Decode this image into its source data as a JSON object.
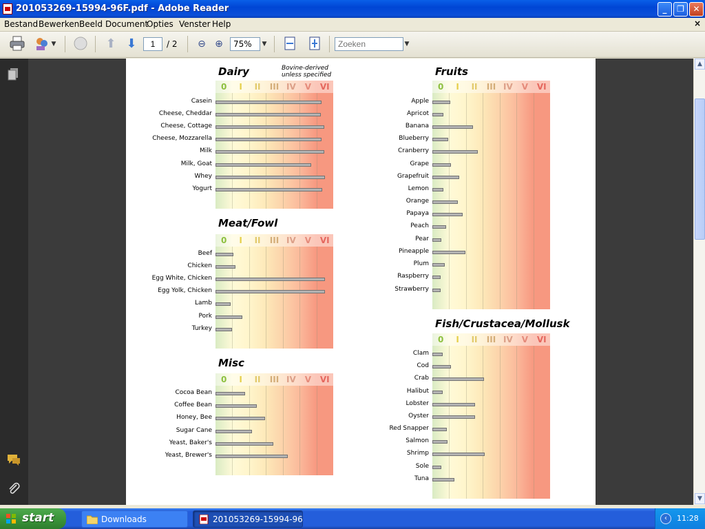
{
  "window": {
    "title": "201053269-15994-96F.pdf - Adobe Reader",
    "controls": [
      "minimize",
      "maximize",
      "close"
    ]
  },
  "menu": {
    "items": [
      "Bestand",
      "Bewerken",
      "Beeld",
      "Document",
      "Opties",
      "Venster",
      "Help"
    ],
    "close_label": "×"
  },
  "toolbar": {
    "page_current": "1",
    "page_total": "/ 2",
    "zoom": "75%",
    "search_placeholder": "Zoeken"
  },
  "document": {
    "zone_labels": [
      "0",
      "I",
      "II",
      "III",
      "IV",
      "V",
      "VI"
    ],
    "zone_colors": [
      "#e6f1cf",
      "#fffbdc",
      "#fff6cc",
      "#fde3b0",
      "#fcc9a6",
      "#fbb39a",
      "#f8a08c"
    ],
    "zone_label_colors": [
      "#8dc03f",
      "#e6cf4a",
      "#e2c96a",
      "#d4ad78",
      "#dc9f88",
      "#e58a7a",
      "#e5675e"
    ],
    "panels": [
      {
        "id": "dairy",
        "title": "Dairy",
        "subtitle_lines": [
          "Bovine-derived",
          "unless specified"
        ],
        "chart_data": {
          "type": "bar",
          "categories": [
            "Casein",
            "Cheese, Cheddar",
            "Cheese, Cottage",
            "Cheese, Mozzarella",
            "Milk",
            "Milk, Goat",
            "Whey",
            "Yogurt"
          ],
          "values": [
            6.3,
            6.25,
            6.45,
            6.3,
            6.45,
            5.7,
            6.5,
            6.35
          ],
          "xlim": [
            0,
            7
          ]
        }
      },
      {
        "id": "meat",
        "title": "Meat/Fowl",
        "subtitle_lines": [],
        "chart_data": {
          "type": "bar",
          "categories": [
            "Beef",
            "Chicken",
            "Egg White, Chicken",
            "Egg Yolk, Chicken",
            "Lamb",
            "Pork",
            "Turkey"
          ],
          "values": [
            1.05,
            1.2,
            6.5,
            6.5,
            0.9,
            1.6,
            1.0
          ],
          "xlim": [
            0,
            7
          ]
        }
      },
      {
        "id": "misc",
        "title": "Misc",
        "subtitle_lines": [],
        "chart_data": {
          "type": "bar",
          "categories": [
            "Cocoa Bean",
            "Coffee Bean",
            "Honey, Bee",
            "Sugar Cane",
            "Yeast, Baker's",
            "Yeast, Brewer's"
          ],
          "values": [
            1.75,
            2.45,
            2.95,
            2.15,
            3.45,
            4.3
          ],
          "xlim": [
            0,
            7
          ]
        }
      },
      {
        "id": "fruits",
        "title": "Fruits",
        "subtitle_lines": [],
        "chart_data": {
          "type": "bar",
          "categories": [
            "Apple",
            "Apricot",
            "Banana",
            "Blueberry",
            "Cranberry",
            "Grape",
            "Grapefruit",
            "Lemon",
            "Orange",
            "Papaya",
            "Peach",
            "Pear",
            "Pineapple",
            "Plum",
            "Raspberry",
            "Strawberry"
          ],
          "values": [
            1.05,
            0.65,
            2.4,
            0.95,
            2.7,
            1.1,
            1.6,
            0.65,
            1.5,
            1.8,
            0.8,
            0.55,
            1.95,
            0.75,
            0.5,
            0.5
          ],
          "xlim": [
            0,
            7
          ]
        }
      },
      {
        "id": "fish",
        "title": "Fish/Crustacea/Mollusk",
        "subtitle_lines": [],
        "chart_data": {
          "type": "bar",
          "categories": [
            "Clam",
            "Cod",
            "Crab",
            "Halibut",
            "Lobster",
            "Oyster",
            "Red Snapper",
            "Salmon",
            "Shrimp",
            "Sole",
            "Tuna"
          ],
          "values": [
            0.6,
            1.1,
            3.05,
            0.6,
            2.55,
            2.55,
            0.85,
            0.9,
            3.1,
            0.55,
            1.3
          ],
          "xlim": [
            0,
            7
          ]
        }
      }
    ]
  },
  "taskbar": {
    "start_label": "start",
    "tasks": [
      {
        "label": "Downloads",
        "active": false
      },
      {
        "label": "201053269-15994-96...",
        "active": true
      }
    ],
    "clock": "11:28"
  }
}
